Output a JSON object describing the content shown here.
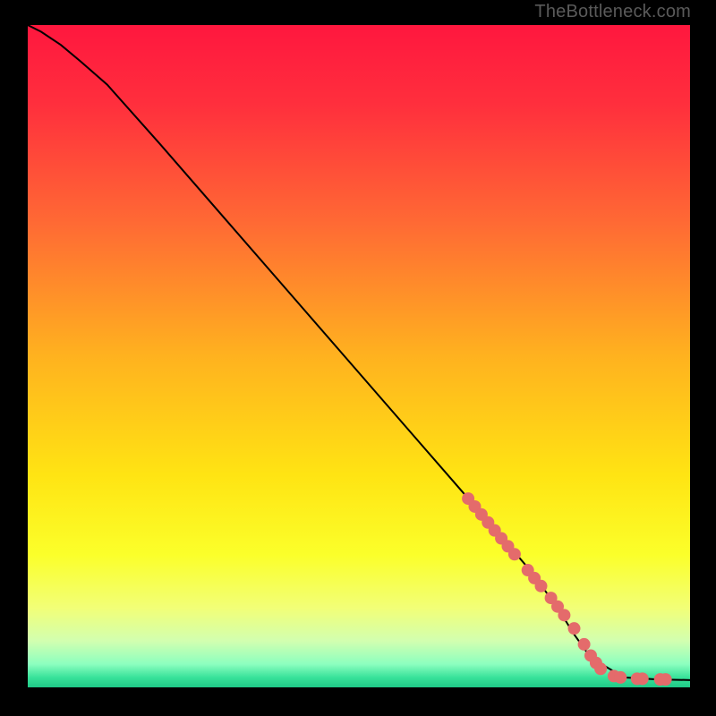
{
  "attribution": "TheBottleneck.com",
  "colors": {
    "frame": "#000000",
    "curve": "#000000",
    "points": "#e46b6b",
    "gradient_stops": [
      {
        "offset": 0.0,
        "color": "#ff173e"
      },
      {
        "offset": 0.12,
        "color": "#ff2f3d"
      },
      {
        "offset": 0.3,
        "color": "#ff6a34"
      },
      {
        "offset": 0.5,
        "color": "#ffb21f"
      },
      {
        "offset": 0.68,
        "color": "#ffe413"
      },
      {
        "offset": 0.8,
        "color": "#fbff2a"
      },
      {
        "offset": 0.88,
        "color": "#f2ff77"
      },
      {
        "offset": 0.93,
        "color": "#d2ffb0"
      },
      {
        "offset": 0.965,
        "color": "#8cffbf"
      },
      {
        "offset": 0.985,
        "color": "#38e29a"
      },
      {
        "offset": 1.0,
        "color": "#1fc987"
      }
    ]
  },
  "chart_data": {
    "type": "line",
    "title": "",
    "xlabel": "",
    "ylabel": "",
    "xlim": [
      0,
      100
    ],
    "ylim": [
      0,
      100
    ],
    "grid": false,
    "legend": false,
    "series": [
      {
        "name": "bottleneck-curve",
        "x": [
          0,
          2,
          5,
          8,
          12,
          20,
          30,
          40,
          50,
          60,
          70,
          76,
          80,
          82.5,
          85,
          90,
          95,
          100
        ],
        "y": [
          100,
          99,
          97,
          94.5,
          91,
          82,
          70.5,
          59,
          47.5,
          36,
          24.5,
          17.5,
          12,
          8,
          4.5,
          1.5,
          1.2,
          1.1
        ]
      }
    ],
    "points": {
      "name": "highlighted-segment",
      "x": [
        66.5,
        67.5,
        68.5,
        69.5,
        70.5,
        71.5,
        72.5,
        73.5,
        75.5,
        76.5,
        77.5,
        79,
        80,
        81,
        82.5,
        84,
        85,
        85.8,
        86.5,
        88.5,
        89.5,
        92,
        92.8,
        95.5,
        96.3
      ],
      "y": [
        28.5,
        27.3,
        26.1,
        24.9,
        23.7,
        22.5,
        21.3,
        20.1,
        17.7,
        16.5,
        15.3,
        13.5,
        12.2,
        10.9,
        8.9,
        6.5,
        4.8,
        3.7,
        2.8,
        1.7,
        1.5,
        1.3,
        1.3,
        1.2,
        1.2
      ]
    }
  }
}
